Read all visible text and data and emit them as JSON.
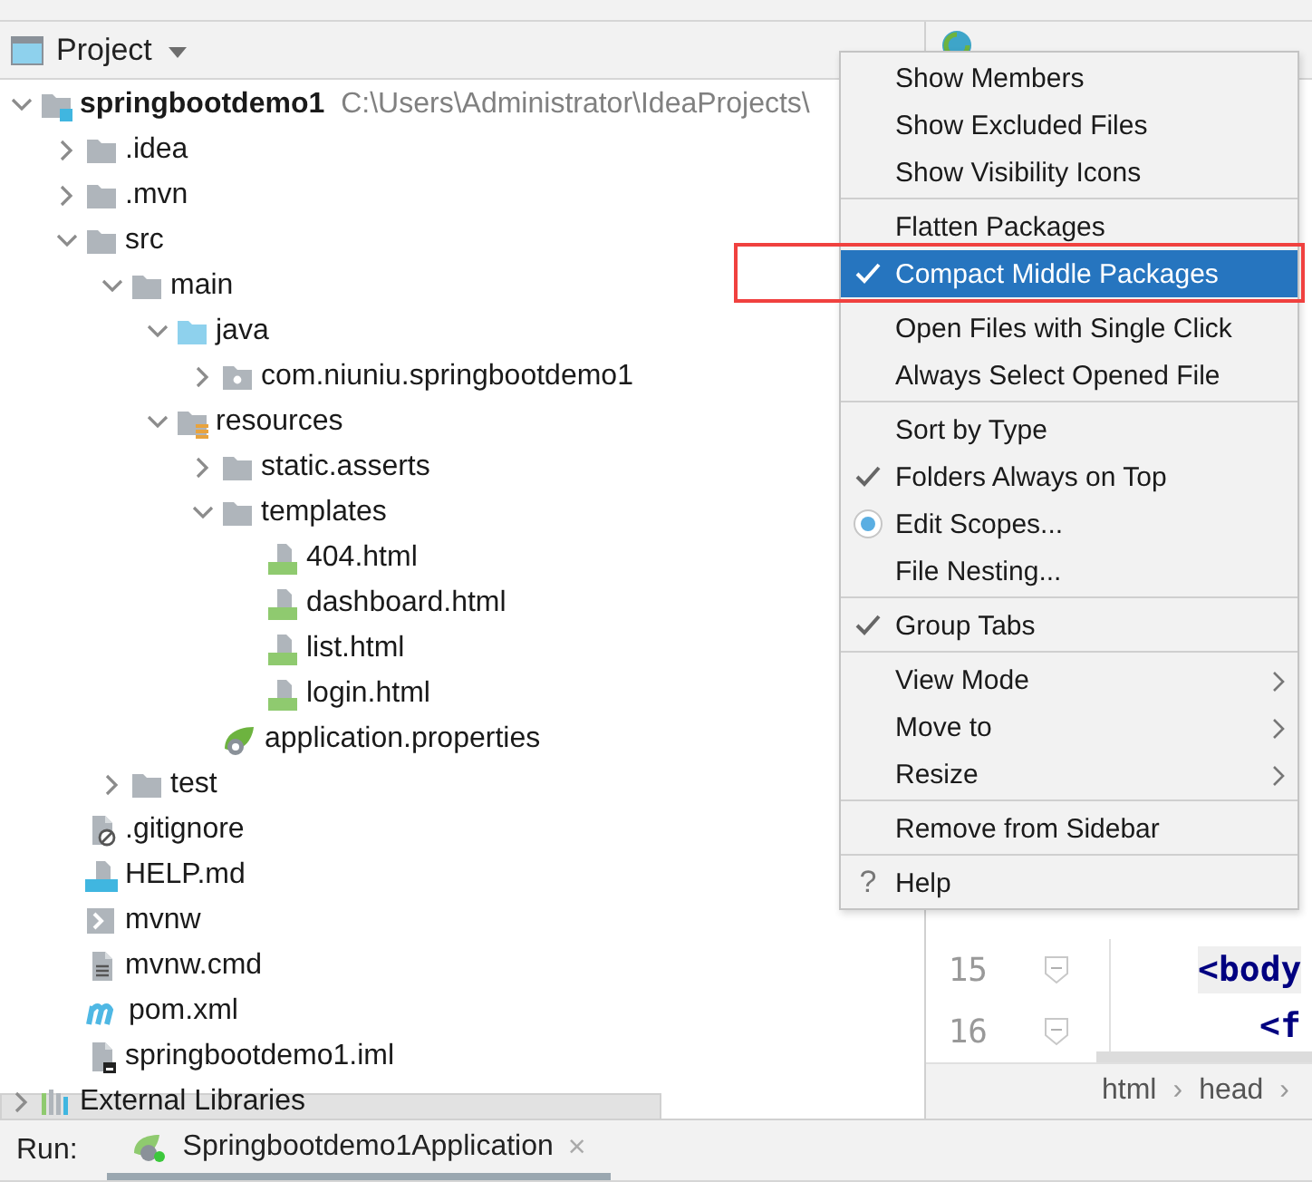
{
  "project_panel": {
    "title": "Project"
  },
  "tree": [
    {
      "label": "springbootdemo1",
      "kind": "module",
      "expanded": true,
      "path": "C:\\Users\\Administrator\\IdeaProjects\\",
      "children": [
        {
          "label": ".idea",
          "kind": "folder",
          "expanded": false
        },
        {
          "label": ".mvn",
          "kind": "folder",
          "expanded": false
        },
        {
          "label": "src",
          "kind": "folder",
          "expanded": true,
          "children": [
            {
              "label": "main",
              "kind": "folder",
              "expanded": true,
              "children": [
                {
                  "label": "java",
                  "kind": "source-folder",
                  "expanded": true,
                  "children": [
                    {
                      "label": "com.niuniu.springbootdemo1",
                      "kind": "package",
                      "expanded": false
                    }
                  ]
                },
                {
                  "label": "resources",
                  "kind": "resources-folder",
                  "expanded": true,
                  "children": [
                    {
                      "label": "static.asserts",
                      "kind": "folder",
                      "expanded": false
                    },
                    {
                      "label": "templates",
                      "kind": "folder",
                      "expanded": true,
                      "children": [
                        {
                          "label": "404.html",
                          "kind": "html"
                        },
                        {
                          "label": "dashboard.html",
                          "kind": "html"
                        },
                        {
                          "label": "list.html",
                          "kind": "html"
                        },
                        {
                          "label": "login.html",
                          "kind": "html"
                        }
                      ]
                    },
                    {
                      "label": "application.properties",
                      "kind": "spring"
                    }
                  ]
                }
              ]
            },
            {
              "label": "test",
              "kind": "folder",
              "expanded": false
            }
          ]
        },
        {
          "label": ".gitignore",
          "kind": "ignore"
        },
        {
          "label": "HELP.md",
          "kind": "markdown"
        },
        {
          "label": "mvnw",
          "kind": "shell"
        },
        {
          "label": "mvnw.cmd",
          "kind": "text"
        },
        {
          "label": "pom.xml",
          "kind": "maven"
        },
        {
          "label": "springbootdemo1.iml",
          "kind": "module-file"
        }
      ]
    },
    {
      "label": "External Libraries",
      "kind": "libraries",
      "expanded": false
    }
  ],
  "menu": {
    "groups": [
      [
        {
          "label": "Show Members",
          "kind": "toggle",
          "checked": false,
          "selected": false,
          "outlined": false
        },
        {
          "label": "Show Excluded Files",
          "kind": "toggle",
          "checked": false,
          "selected": false,
          "outlined": false
        },
        {
          "label": "Show Visibility Icons",
          "kind": "toggle",
          "checked": false,
          "selected": false,
          "outlined": false
        }
      ],
      [
        {
          "label": "Flatten Packages",
          "kind": "toggle",
          "checked": false,
          "selected": false,
          "outlined": false
        },
        {
          "label": "Compact Middle Packages",
          "kind": "toggle",
          "checked": true,
          "selected": true,
          "outlined": true
        }
      ],
      [
        {
          "label": "Open Files with Single Click",
          "kind": "toggle",
          "checked": false,
          "selected": false,
          "outlined": false
        },
        {
          "label": "Always Select Opened File",
          "kind": "toggle",
          "checked": false,
          "selected": false,
          "outlined": false
        }
      ],
      [
        {
          "label": "Sort by Type",
          "kind": "toggle",
          "checked": false,
          "selected": false,
          "outlined": false
        },
        {
          "label": "Folders Always on Top",
          "kind": "toggle",
          "checked": true,
          "selected": false,
          "outlined": false
        },
        {
          "label": "Edit Scopes...",
          "kind": "radio",
          "checked": true,
          "selected": false,
          "outlined": false
        },
        {
          "label": "File Nesting...",
          "kind": "toggle",
          "checked": false,
          "selected": false,
          "outlined": false
        }
      ],
      [
        {
          "label": "Group Tabs",
          "kind": "toggle",
          "checked": true,
          "selected": false,
          "outlined": false
        }
      ],
      [
        {
          "label": "View Mode",
          "kind": "submenu",
          "checked": false,
          "selected": false,
          "outlined": false
        },
        {
          "label": "Move to",
          "kind": "submenu",
          "checked": false,
          "selected": false,
          "outlined": false
        },
        {
          "label": "Resize",
          "kind": "submenu",
          "checked": false,
          "selected": false,
          "outlined": false
        }
      ],
      [
        {
          "label": "Remove from Sidebar",
          "kind": "toggle",
          "checked": false,
          "selected": false,
          "outlined": false
        }
      ],
      [
        {
          "label": "Help",
          "kind": "help",
          "glyph": "?",
          "selected": false,
          "outlined": false
        }
      ]
    ]
  },
  "editor": {
    "lines": [
      {
        "number": "15",
        "code": "<body",
        "kind": "line"
      },
      {
        "number": "16",
        "code": "<f",
        "kind": "nested-line"
      }
    ],
    "breadcrumbs": [
      {
        "label": "html"
      },
      {
        "label": "head"
      }
    ],
    "separator": "›"
  },
  "run_bar": {
    "label": "Run:",
    "tabs": [
      {
        "label": "Springbootdemo1Application",
        "close": "×",
        "selected": true
      }
    ]
  }
}
